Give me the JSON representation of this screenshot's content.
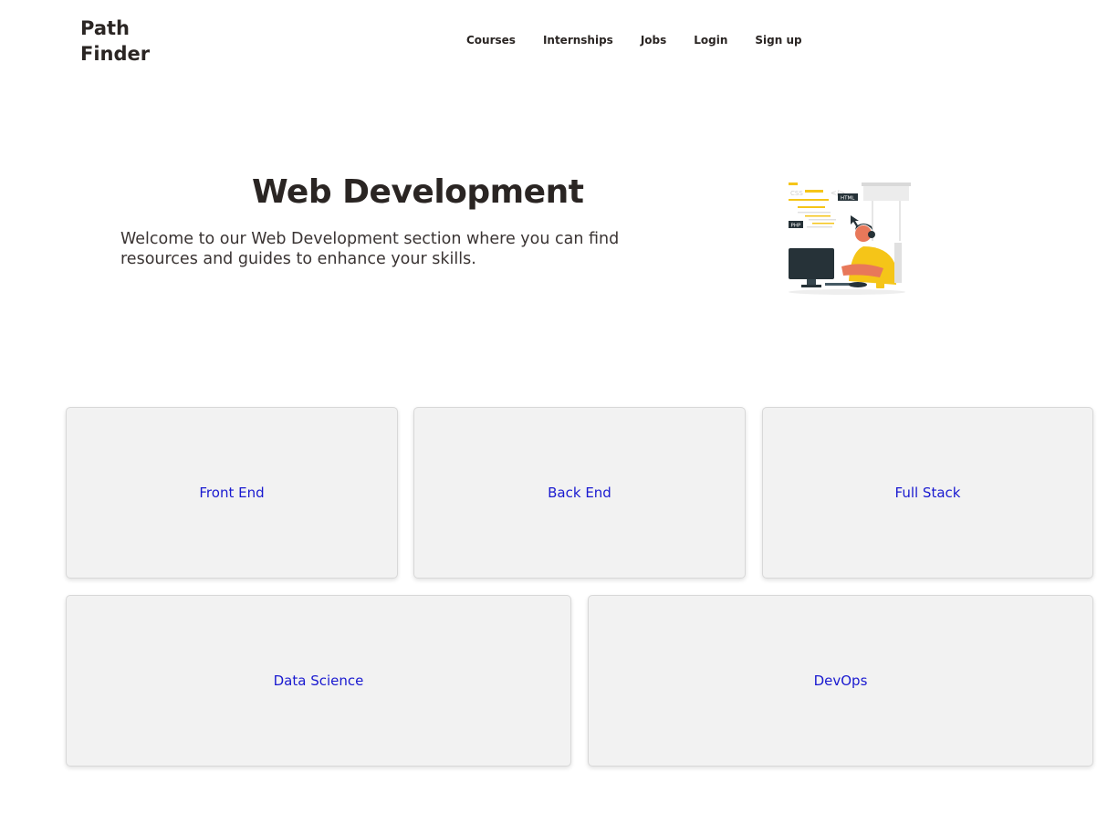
{
  "brand": {
    "line1": "Path",
    "line2": "Finder"
  },
  "nav": {
    "courses": "Courses",
    "internships": "Internships",
    "jobs": "Jobs",
    "login": "Login",
    "signup": "Sign up"
  },
  "hero": {
    "title": "Web Development",
    "description": "Welcome to our Web Development section where you can find resources and guides to enhance your skills.",
    "illustration_labels": {
      "css": "CSS",
      "html": "HTML",
      "php": "PHP",
      "code": "</>"
    }
  },
  "cards": {
    "front_end": "Front End",
    "back_end": "Back End",
    "full_stack": "Full Stack",
    "data_science": "Data Science",
    "devops": "DevOps"
  },
  "colors": {
    "accent": "#1a1ad0",
    "card_bg": "#f2f2f2",
    "text": "#2a2523"
  }
}
